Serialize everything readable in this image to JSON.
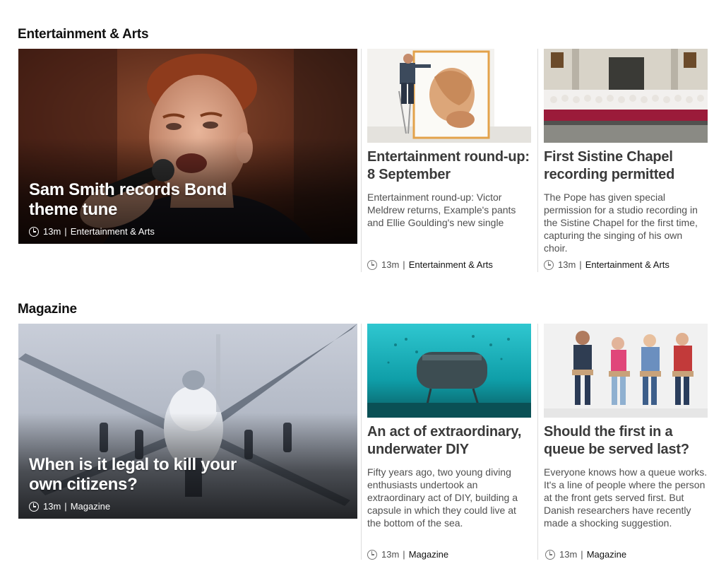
{
  "sections": [
    {
      "title": "Entertainment & Arts",
      "feature": {
        "headline": "Sam Smith records Bond theme tune",
        "time": "13m",
        "category": "Entertainment & Arts"
      },
      "cards": [
        {
          "title": "Entertainment round-up: 8 September",
          "summary": "Entertainment round-up: Victor Meldrew returns, Example's pants and Ellie Goulding's new single",
          "time": "13m",
          "category": "Entertainment & Arts"
        },
        {
          "title": "First Sistine Chapel recording permitted",
          "summary": "The Pope has given special permission for a studio recording in the Sistine Chapel for the first time, capturing the singing of his own choir.",
          "time": "13m",
          "category": "Entertainment & Arts"
        }
      ]
    },
    {
      "title": "Magazine",
      "feature": {
        "headline": "When is it legal to kill your own citizens?",
        "time": "13m",
        "category": "Magazine"
      },
      "cards": [
        {
          "title": "An act of extraordinary, underwater DIY",
          "summary": "Fifty years ago, two young diving enthusiasts undertook an extraordinary act of DIY, building a capsule in which they could live at the bottom of the sea.",
          "time": "13m",
          "category": "Magazine"
        },
        {
          "title": "Should the first in a queue be served last?",
          "summary": "Everyone knows how a queue works. It's a line of people where the person at the front gets served first. But Danish researchers have recently made a shocking suggestion.",
          "time": "13m",
          "category": "Magazine"
        }
      ]
    }
  ],
  "separator": "|",
  "icons": {
    "time": "clock-icon"
  }
}
